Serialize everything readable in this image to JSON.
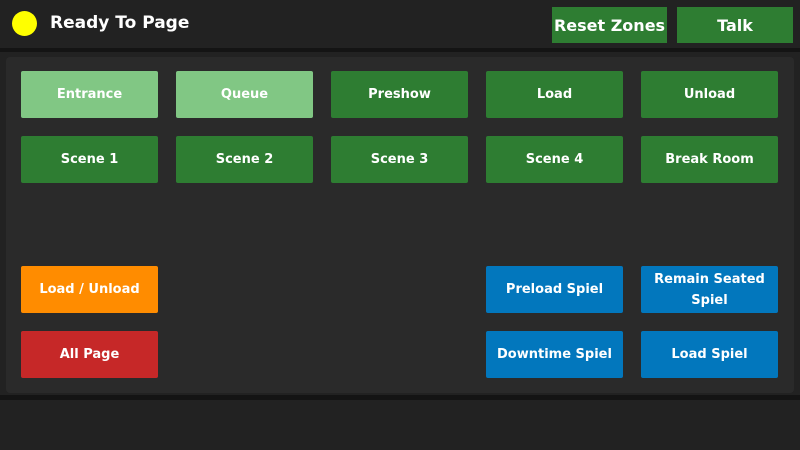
{
  "header": {
    "status_text": "Ready To Page",
    "status_color": "#ffff00",
    "reset_zones_label": "Reset Zones",
    "talk_label": "Talk"
  },
  "colors": {
    "background": "#222222",
    "panel": "#2a2a2a",
    "zone_default": "#2e7d32",
    "zone_selected": "#81c784",
    "load_unload": "#ff8c00",
    "all_page": "#c62828",
    "spiel": "#0277bd"
  },
  "zones": {
    "row1": [
      "Entrance",
      "Queue",
      "Preshow",
      "Load",
      "Unload"
    ],
    "row2": [
      "Scene 1",
      "Scene 2",
      "Scene 3",
      "Scene 4",
      "Break Room"
    ],
    "selected": [
      "Entrance",
      "Queue"
    ]
  },
  "actions": {
    "load_unload_label": "Load / Unload",
    "all_page_label": "All Page"
  },
  "spiels": {
    "preload_label": "Preload Spiel",
    "remain_seated_label": "Remain Seated Spiel",
    "downtime_label": "Downtime Spiel",
    "load_label": "Load Spiel"
  }
}
